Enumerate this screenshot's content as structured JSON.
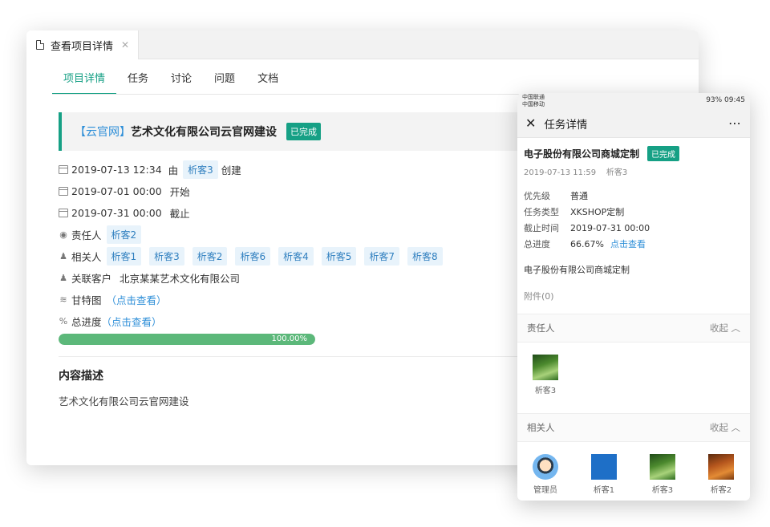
{
  "desktop": {
    "window_tab": "查看项目详情",
    "tabs": [
      "项目详情",
      "任务",
      "讨论",
      "问题",
      "文档"
    ],
    "project": {
      "prefix": "【云官网】",
      "name": "艺术文化有限公司云官网建设",
      "status": "已完成"
    },
    "created": {
      "date": "2019-07-13 12:34",
      "by_label": "由",
      "user": "析客3",
      "action": "创建"
    },
    "start": {
      "date": "2019-07-01 00:00",
      "label": "开始"
    },
    "end": {
      "date": "2019-07-31 00:00",
      "label": "截止"
    },
    "owner": {
      "label": "责任人",
      "user": "析客2"
    },
    "related": {
      "label": "相关人",
      "users": [
        "析客1",
        "析客3",
        "析客2",
        "析客6",
        "析客4",
        "析客5",
        "析客7",
        "析客8"
      ]
    },
    "customer": {
      "label": "关联客户",
      "value": "北京某某艺术文化有限公司"
    },
    "gantt": {
      "label": "甘特图",
      "link": "（点击查看）"
    },
    "progress": {
      "label": "总进度",
      "link": "（点击查看）",
      "value": 1.0,
      "text": "100.00%"
    },
    "description": {
      "title": "内容描述",
      "text": "艺术文化有限公司云官网建设"
    }
  },
  "phone": {
    "status_left": [
      "中国联通",
      "中国移动"
    ],
    "status_right": "93% 09:45",
    "header_title": "任务详情",
    "task_title": "电子股份有限公司商城定制",
    "status": "已完成",
    "meta": "2019-07-13 11:59    析客3",
    "fields": [
      {
        "k": "优先级",
        "v": "普通"
      },
      {
        "k": "任务类型",
        "v": "XKSHOP定制"
      },
      {
        "k": "截止时间",
        "v": "2019-07-31 00:00"
      },
      {
        "k": "总进度",
        "v": "66.67%",
        "link": "点击查看"
      }
    ],
    "desc": "电子股份有限公司商城定制",
    "attachments": "附件(0)",
    "owner_section": {
      "title": "责任人",
      "collapse": "收起"
    },
    "owner": {
      "name": "析客3"
    },
    "related_section": {
      "title": "相关人",
      "collapse": "收起"
    },
    "related": [
      "管理员",
      "析客1",
      "析客3",
      "析客2"
    ]
  }
}
